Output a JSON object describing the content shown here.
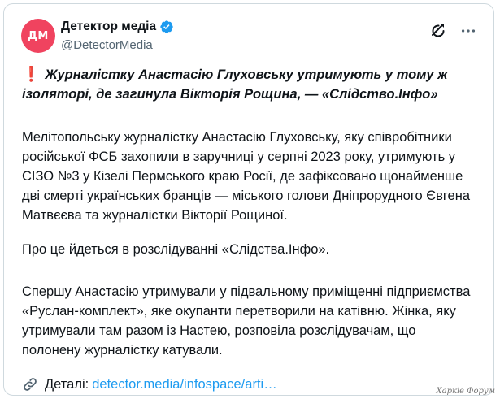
{
  "author": {
    "avatar_text": "ДМ",
    "display_name": "Детектор медіа",
    "handle": "@DetectorMedia",
    "verified": true
  },
  "icons": {
    "verified": "verified-badge-icon",
    "grok": "grok-icon",
    "more": "more-icon",
    "link": "link-icon"
  },
  "colors": {
    "avatar_bg": "#f0435f",
    "link": "#1d9bf0",
    "verified": "#1d9bf0",
    "exclamation": "#e0245e"
  },
  "post": {
    "headline_mark": "❗",
    "headline": "Журналістку Анастасію Глуховську утримують у тому ж ізоляторі, де загинула Вікторія Рощина, — «Слідство.Інфо»",
    "paragraph1": "Мелітопольську журналістку Анастасію Глуховську, яку співробітники російської ФСБ захопили в заручниці у серпні 2023 року, утримують у СІЗО №3 у Кізелі Пермського краю Росії, де зафіксовано щонайменше дві смерті українських бранців — міського голови Дніпрорудного Євгена Матвєєва та журналістки Вікторії Рощиної.",
    "paragraph2": "Про це йдеться в розслідуванні «Слідства.Інфо».",
    "paragraph3": "Спершу Анастасію утримували у підвальному приміщенні підприємства «Руслан-комплект», яке окупанти перетворили на катівню. Жінка, яку утримували там разом із Настею, розповіла розслідувачам, що полонену журналістку катували.",
    "details_label": "Деталі:",
    "details_link": "detector.media/infospace/arti…"
  },
  "watermark": "Харків Форум"
}
